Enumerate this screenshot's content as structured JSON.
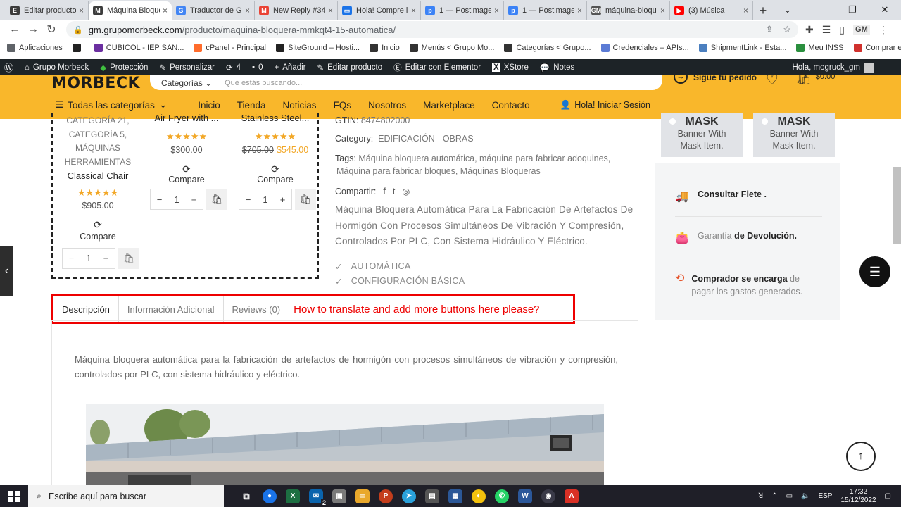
{
  "browser": {
    "tabs": [
      {
        "label": "Editar producto",
        "color": "#3c3c3c",
        "glyph": "E"
      },
      {
        "label": "Máquina Bloque",
        "color": "#3c3c3c",
        "glyph": "M",
        "active": true
      },
      {
        "label": "Traductor de G",
        "color": "#4285f4",
        "glyph": "G"
      },
      {
        "label": "New Reply #34",
        "color": "#ea4335",
        "glyph": "M"
      },
      {
        "label": "Hola! Compre l",
        "color": "#1a73e8",
        "glyph": "▭"
      },
      {
        "label": "1 — Postimage",
        "color": "#3b82f6",
        "glyph": "p"
      },
      {
        "label": "1 — Postimage",
        "color": "#3b82f6",
        "glyph": "p"
      },
      {
        "label": "máquina-bloqu",
        "color": "#555",
        "glyph": "GM"
      },
      {
        "label": "(3) Música",
        "color": "#ff0000",
        "glyph": "▶"
      }
    ],
    "url_host": "gm.grupomorbeck.com",
    "url_path": "/producto/maquina-bloquera-mmkqt4-15-automatica/",
    "bookmarks": [
      {
        "label": "Aplicaciones",
        "color": "#5f6368"
      },
      {
        "label": "",
        "color": "#222"
      },
      {
        "label": "CUBICOL - IEP SAN...",
        "color": "#6b2fa0"
      },
      {
        "label": "cPanel - Principal",
        "color": "#ff6c2c"
      },
      {
        "label": "SiteGround – Hosti...",
        "color": "#222"
      },
      {
        "label": "Inicio",
        "color": "#333"
      },
      {
        "label": "Menús < Grupo Mo...",
        "color": "#333"
      },
      {
        "label": "Categorías < Grupo...",
        "color": "#333"
      },
      {
        "label": "Credenciales – APIs...",
        "color": "#5b7bd5"
      },
      {
        "label": "ShipmentLink - Esta...",
        "color": "#4b7fbf"
      },
      {
        "label": "Meu INSS",
        "color": "#2a8f3e"
      },
      {
        "label": "Comprar en USA de...",
        "color": "#d0312d"
      }
    ],
    "ext_label": "GM"
  },
  "wpbar": {
    "site": "Grupo Morbeck",
    "protection": "Protección",
    "customize": "Personalizar",
    "updates": "4",
    "comments": "0",
    "add": "Añadir",
    "edit_product": "Editar producto",
    "elementor": "Editar con Elementor",
    "xstore": "XStore",
    "notes": "Notes",
    "greeting": "Hola, mogruck_gm"
  },
  "header": {
    "logo": "MORBECK",
    "search_category": "Categorías",
    "search_placeholder": "Qué estás buscando...",
    "track_order": "Sigue tu pedido",
    "cart_total": "$0.00",
    "all_categories": "Todas las categorías",
    "nav": [
      "Inicio",
      "Tienda",
      "Noticias",
      "FQs",
      "Nosotros",
      "Marketplace",
      "Contacto"
    ],
    "login": "Hola! Iniciar Sesión"
  },
  "products": [
    {
      "cats": [
        "CATEGORÍA 21,",
        "CATEGORÍA 5,",
        "MÁQUINAS",
        "HERRAMIENTAS"
      ],
      "name": "Classical Chair",
      "stars": "★★★★★",
      "price": "$905.00",
      "compare": "Compare",
      "qty": "1"
    },
    {
      "name": "Air Fryer with ...",
      "stars": "★★★★★",
      "price": "$300.00",
      "compare": "Compare",
      "qty": "1"
    },
    {
      "name": "Stainless Steel...",
      "stars": "★★★★★",
      "old_price": "$705.00",
      "price": "$545.00",
      "compare": "Compare",
      "qty": "1"
    }
  ],
  "detail": {
    "gtin_label": "GTIN:",
    "gtin": "8474802000",
    "category_label": "Category:",
    "category": "EDIFICACIÓN - OBRAS",
    "tags_label": "Tags:",
    "tags_line1": "Máquina bloquera automática, máquina para fabricar adoquines,",
    "tags_line2": "Máquina para fabricar bloques, Máquinas Bloqueras",
    "share_label": "Compartir:",
    "short_desc": "Máquina Bloquera Automática Para La Fabricación De Artefactos De Hormigón Con Procesos Simultáneos De Vibración Y Compresión, Controlados Por PLC, Con Sistema Hidráulico Y Eléctrico.",
    "features": [
      "AUTOMÁTICA",
      "CONFIGURACIÓN BÁSICA"
    ]
  },
  "sidebar": {
    "banners": [
      {
        "title": "MASK",
        "text1": "Banner With",
        "text2": "Mask Item."
      },
      {
        "title": "MASK",
        "text1": "Banner With",
        "text2": "Mask Item."
      }
    ],
    "info": [
      {
        "bold": "Consultar Flete .",
        "rest": ""
      },
      {
        "pre": "Garantía ",
        "bold": "de Devolución."
      },
      {
        "bold": "Comprador se encarga",
        "rest": " de pagar los gastos generados."
      }
    ]
  },
  "tabs": {
    "items": [
      "Descripción",
      "Información Adicional",
      "Reviews (0)"
    ],
    "annotation": "How to translate and add more buttons here please?"
  },
  "description": "Máquina bloquera automática para la fabricación de artefactos de hormigón con procesos simultáneos de vibración y compresión, controlados por PLC, con sistema hidráulico y eléctrico.",
  "taskbar": {
    "search": "Escribe aquí para buscar",
    "lang": "ESP",
    "time": "17:32",
    "date": "15/12/2022",
    "mail_badge": "2"
  },
  "colors": {
    "brand": "#f9b72b",
    "accent_red": "#e00000",
    "star": "#f2a726"
  }
}
